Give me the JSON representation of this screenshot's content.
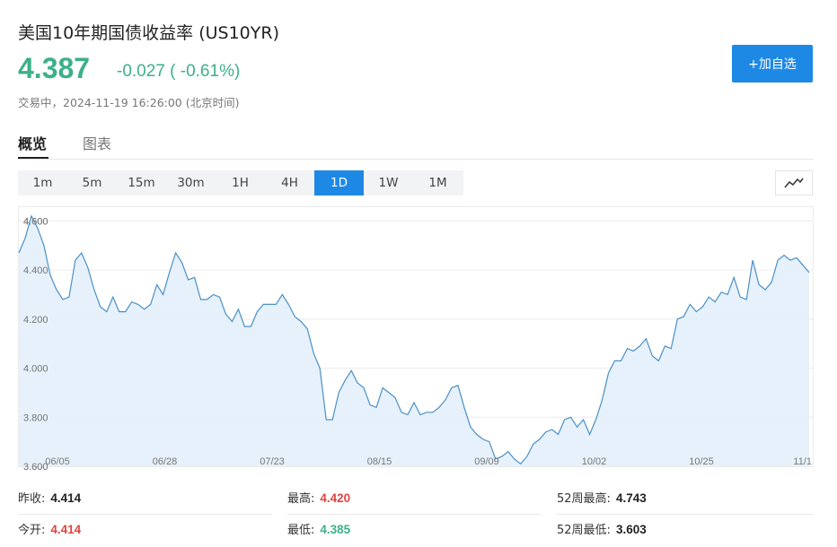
{
  "header": {
    "title": "美国10年期国债收益率 (US10YR)",
    "price": "4.387",
    "change": "-0.027 ( -0.61%)",
    "status": "交易中，2024-11-19 16:26:00 (北京时间)",
    "add_button": "+加自选"
  },
  "tabs": [
    {
      "label": "概览",
      "active": true
    },
    {
      "label": "图表",
      "active": false
    }
  ],
  "periods": [
    {
      "label": "1m",
      "active": false
    },
    {
      "label": "5m",
      "active": false
    },
    {
      "label": "15m",
      "active": false
    },
    {
      "label": "30m",
      "active": false
    },
    {
      "label": "1H",
      "active": false
    },
    {
      "label": "4H",
      "active": false
    },
    {
      "label": "1D",
      "active": true
    },
    {
      "label": "1W",
      "active": false
    },
    {
      "label": "1M",
      "active": false
    }
  ],
  "chart_type_icon": "line-chart-icon",
  "colors": {
    "up": "#3cb08a",
    "down_red": "#e0443f",
    "accent": "#1e88e5",
    "line": "#4a90c8",
    "area": "#e3f0fb"
  },
  "stats": [
    {
      "label": "昨收:",
      "value": "4.414",
      "color": "dark"
    },
    {
      "label": "最高:",
      "value": "4.420",
      "color": "red"
    },
    {
      "label": "52周最高:",
      "value": "4.743",
      "color": "dark"
    },
    {
      "label": "今开:",
      "value": "4.414",
      "color": "red"
    },
    {
      "label": "最低:",
      "value": "4.385",
      "color": "green"
    },
    {
      "label": "52周最低:",
      "value": "3.603",
      "color": "dark"
    }
  ],
  "chart_data": {
    "type": "area",
    "title": "",
    "xlabel": "",
    "ylabel": "",
    "ylim": [
      3.6,
      4.66
    ],
    "y_ticks": [
      "3.600",
      "3.800",
      "4.000",
      "4.200",
      "4.400",
      "4.600"
    ],
    "x_ticks": [
      "06/05",
      "06/28",
      "07/23",
      "08/15",
      "09/09",
      "10/02",
      "10/25",
      "11/1"
    ],
    "grid": true,
    "series": [
      {
        "values": [
          4.47,
          4.53,
          4.62,
          4.57,
          4.5,
          4.38,
          4.32,
          4.28,
          4.29,
          4.44,
          4.47,
          4.41,
          4.32,
          4.25,
          4.23,
          4.29,
          4.23,
          4.23,
          4.27,
          4.26,
          4.24,
          4.26,
          4.34,
          4.3,
          4.39,
          4.47,
          4.43,
          4.36,
          4.37,
          4.28,
          4.28,
          4.3,
          4.29,
          4.22,
          4.19,
          4.24,
          4.17,
          4.17,
          4.23,
          4.26,
          4.26,
          4.26,
          4.3,
          4.26,
          4.21,
          4.19,
          4.16,
          4.06,
          4.0,
          3.79,
          3.79,
          3.9,
          3.95,
          3.99,
          3.94,
          3.92,
          3.85,
          3.84,
          3.92,
          3.9,
          3.88,
          3.82,
          3.81,
          3.86,
          3.81,
          3.82,
          3.82,
          3.84,
          3.87,
          3.92,
          3.93,
          3.84,
          3.76,
          3.73,
          3.71,
          3.7,
          3.63,
          3.64,
          3.66,
          3.63,
          3.61,
          3.64,
          3.69,
          3.71,
          3.74,
          3.75,
          3.73,
          3.79,
          3.8,
          3.76,
          3.79,
          3.73,
          3.79,
          3.87,
          3.98,
          4.03,
          4.03,
          4.08,
          4.07,
          4.09,
          4.12,
          4.05,
          4.03,
          4.09,
          4.08,
          4.2,
          4.21,
          4.26,
          4.23,
          4.25,
          4.29,
          4.27,
          4.31,
          4.3,
          4.37,
          4.29,
          4.28,
          4.44,
          4.34,
          4.32,
          4.35,
          4.44,
          4.46,
          4.44,
          4.45,
          4.42,
          4.39
        ]
      }
    ]
  }
}
